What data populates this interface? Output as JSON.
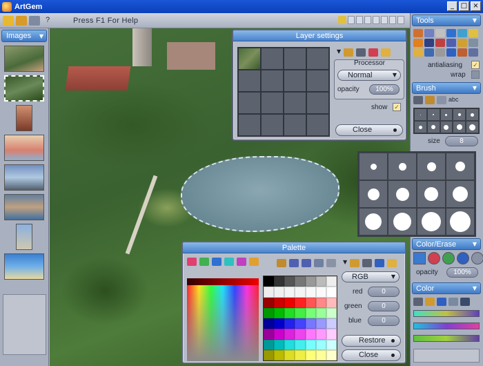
{
  "window": {
    "title": "ArtGem",
    "controls": [
      "_",
      "□",
      "×"
    ]
  },
  "toolbar": {
    "help_text": "Press F1 For Help"
  },
  "images_panel": {
    "title": "Images",
    "thumbnails": [
      "aerial city",
      "aerial park",
      "portrait",
      "child",
      "harbor",
      "river town",
      "tower",
      "beach"
    ]
  },
  "layer_settings": {
    "title": "Layer settings",
    "processor_label": "Processor",
    "mode": "Normal",
    "opacity_label": "opacity",
    "opacity_value": "100%",
    "show_label": "show",
    "close_label": "Close"
  },
  "tools": {
    "title": "Tools",
    "antialiasing_label": "antialiasing",
    "wrap_label": "wrap"
  },
  "brush": {
    "title": "Brush",
    "abc_label": "abc",
    "size_label": "size",
    "size_value": "8"
  },
  "color_erase": {
    "title": "Color/Erase",
    "opacity_label": "opacity",
    "opacity_value": "100%"
  },
  "color_panel": {
    "title": "Color"
  },
  "palette": {
    "title": "Palette",
    "mode": "RGB",
    "red_label": "red",
    "red_value": "0",
    "green_label": "green",
    "green_value": "0",
    "blue_label": "blue",
    "blue_value": "0",
    "restore_label": "Restore",
    "close_label": "Close"
  },
  "colors": {
    "titlebar": "#1a57d8",
    "panel_head": "#4a82cc",
    "panel_bg": "#a9b0bf"
  }
}
